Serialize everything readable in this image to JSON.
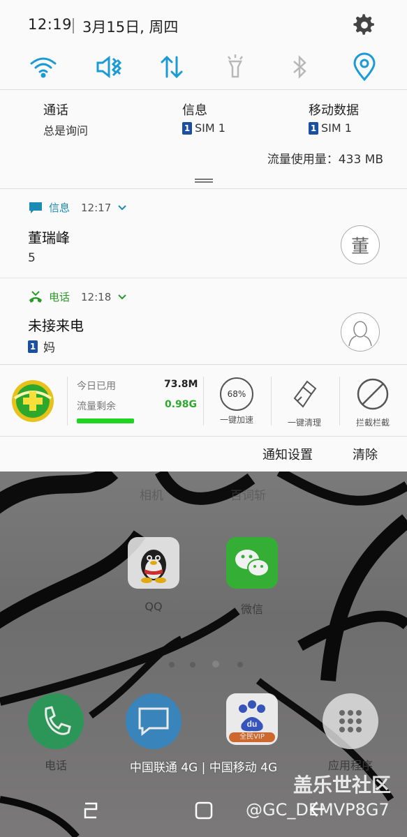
{
  "status_bar": {
    "time": "12:19",
    "date": "3月15日, 周四"
  },
  "quick_settings": {
    "colors": {
      "active": "#1a9ad6",
      "inactive": "#b8b8b8"
    },
    "toggles": [
      {
        "name": "wifi",
        "icon": "wifi-icon",
        "active": true
      },
      {
        "name": "sound",
        "icon": "vibrate-icon",
        "active": true
      },
      {
        "name": "data",
        "icon": "mobile-data-icon",
        "active": true
      },
      {
        "name": "flashlight",
        "icon": "flashlight-icon",
        "active": false
      },
      {
        "name": "bluetooth",
        "icon": "bluetooth-icon",
        "active": false
      },
      {
        "name": "location",
        "icon": "location-icon",
        "active": true
      }
    ]
  },
  "sim_panel": {
    "call": {
      "title": "通话",
      "value": "总是询问"
    },
    "message": {
      "title": "信息",
      "sim_badge": "1",
      "value": "SIM 1"
    },
    "mobile_data": {
      "title": "移动数据",
      "sim_badge": "1",
      "value": "SIM 1"
    },
    "usage": "流量使用量：433 MB"
  },
  "notifications": [
    {
      "app": "信息",
      "time": "12:17",
      "title": "董瑞峰",
      "body": "5",
      "avatar_text": "董",
      "color": "#1b8bb4"
    },
    {
      "app": "电话",
      "time": "12:18",
      "title": "未接来电",
      "sim_badge": "1",
      "body": "妈",
      "color": "#2a9a2a"
    }
  ],
  "security_widget": {
    "today_label": "今日已用",
    "today_value": "73.8M",
    "left_label": "流量剩余",
    "left_value": "0.98G",
    "remaining_fraction": 1.0,
    "boost_percent": "68%",
    "boost_label": "一键加速",
    "clean_label": "一键清理",
    "block_label": "拦截栏截"
  },
  "shade_actions": {
    "settings": "通知设置",
    "clear": "清除"
  },
  "home": {
    "ghost_labels": [
      "相机",
      "百词斩"
    ],
    "apps": [
      {
        "label": "QQ",
        "icon": "qq-icon"
      },
      {
        "label": "微信",
        "icon": "wechat-icon"
      }
    ],
    "dock": [
      {
        "label": "电话",
        "icon": "phone-icon"
      },
      {
        "label": "信息",
        "icon": "message-icon"
      },
      {
        "label": "百度",
        "icon": "baidu-icon",
        "badge": "全民VIP"
      },
      {
        "label": "应用程序",
        "icon": "apps-grid-icon"
      }
    ],
    "carrier_text": "中国联通 4G | 中国移动 4G"
  },
  "watermark": {
    "brand": "盖乐世社区",
    "user": "@GC_DEMVP8G7"
  },
  "nav_bar": {
    "icons": [
      "recent-apps-icon",
      "home-icon",
      "back-icon"
    ]
  }
}
